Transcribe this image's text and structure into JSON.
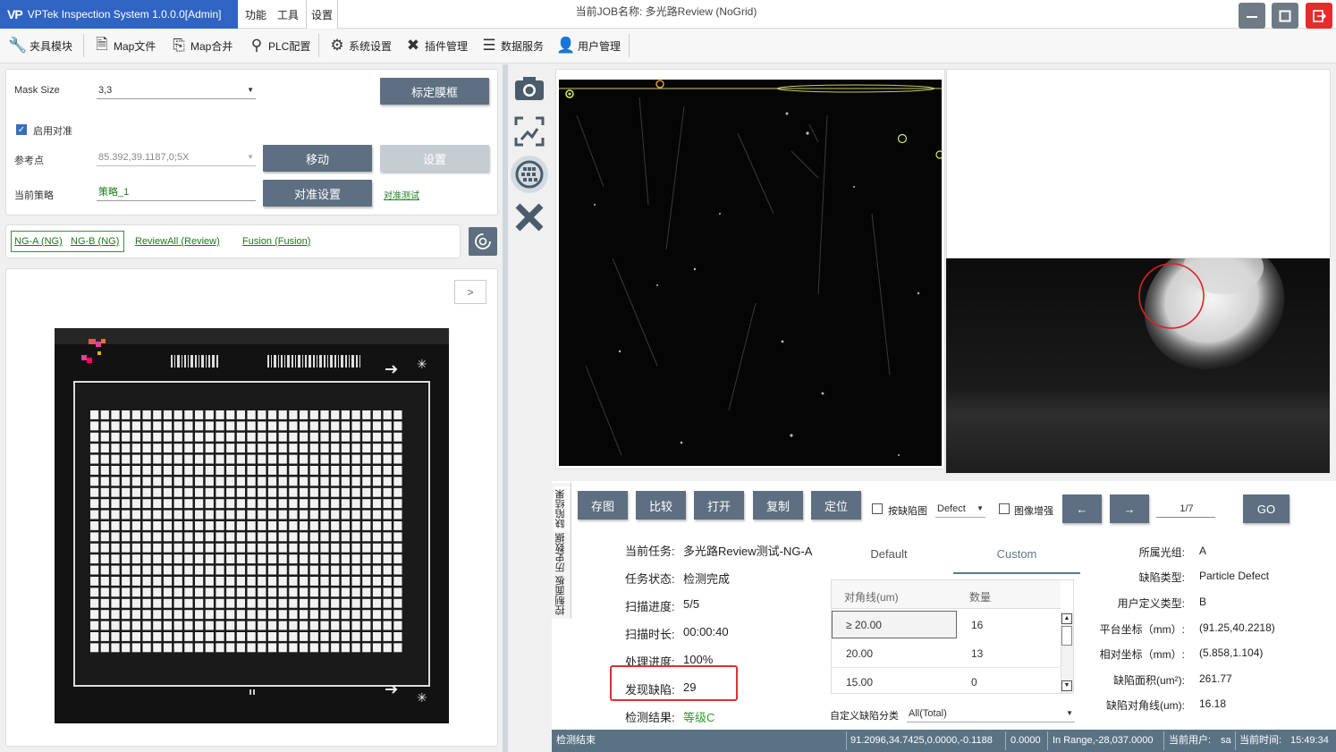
{
  "titlebar": {
    "app_logo": "VP",
    "app_title": "VPTek Inspection System 1.0.0.0[Admin]",
    "menus": [
      "功能",
      "工具",
      "设置"
    ],
    "job_title": "当前JOB名称: 多光路Review (NoGrid)",
    "window_buttons": [
      "minimize-icon",
      "maximize-icon",
      "exit-icon"
    ],
    "exit_color": "#e52b2b"
  },
  "toolbar": [
    {
      "label": "夹具模块",
      "icon": "wrench-icon"
    },
    {
      "label": "Map文件",
      "icon": "document-icon"
    },
    {
      "label": "Map合并",
      "icon": "merge-icon"
    },
    {
      "label": "PLC配置",
      "icon": "plc-icon"
    },
    {
      "label": "系统设置",
      "icon": "gear-icon"
    },
    {
      "label": "插件管理",
      "icon": "tools-icon"
    },
    {
      "label": "数据服务",
      "icon": "server-icon"
    },
    {
      "label": "用户管理",
      "icon": "user-icon"
    }
  ],
  "mask": {
    "label": "Mask Size",
    "value": "3,3",
    "calib_button": "标定膜框",
    "align_enable": "启用对准",
    "ref_label": "参考点",
    "ref_value": "85.392,39.1187,0;5X",
    "move_button": "移动",
    "set_button": "设置",
    "strategy_label": "当前策略",
    "strategy_value": "策略_1",
    "align_settings_button": "对准设置",
    "align_test_link": "对准测试"
  },
  "result_tabs": [
    "NG-A (NG)",
    "NG-B (NG)",
    "ReviewAll (Review)",
    "Fusion (Fusion)"
  ],
  "map": {
    "expand_button": ">"
  },
  "side_icons": [
    "camera-icon",
    "fit-image-icon",
    "wafer-map-icon",
    "measure-icon"
  ],
  "vtabs": [
    "缺陷结果",
    "历史数据",
    "控制面板"
  ],
  "actions": {
    "save": "存图",
    "compare": "比较",
    "open": "打开",
    "copy": "复制",
    "locate": "定位",
    "by_defect_map": "按缺陷图",
    "defect_select": "Defect",
    "enhance": "图像增强",
    "prev": "←",
    "next": "→",
    "page": "1/7",
    "go": "GO"
  },
  "task": {
    "current_task_label": "当前任务:",
    "current_task": "多光路Review测试-NG-A",
    "status_label": "任务状态:",
    "status": "检测完成",
    "scan_progress_label": "扫描进度:",
    "scan_progress": "5/5",
    "scan_time_label": "扫描时长:",
    "scan_time": "00:00:40",
    "process_label": "处理进度:",
    "process": "100%",
    "defects_found_label": "发现缺陷:",
    "defects_found": "29",
    "result_label": "检测结果:",
    "result": "等级C",
    "result_color": "#2e9a2e",
    "highlight_color": "#e03030"
  },
  "table": {
    "tabs": [
      "Default",
      "Custom"
    ],
    "headers": [
      "对角线(um)",
      "数量"
    ],
    "rows": [
      [
        "≥ 20.00",
        "16"
      ],
      [
        "20.00",
        "13"
      ],
      [
        "15.00",
        "0"
      ]
    ],
    "custom_class_label": "自定义缺陷分类",
    "custom_class_value": "All(Total)"
  },
  "defect": {
    "group_label": "所属光组:",
    "group": "A",
    "type_label": "缺陷类型:",
    "type": "Particle Defect",
    "user_type_label": "用户定义类型:",
    "user_type": "B",
    "stage_label": "平台坐标（mm）:",
    "stage": "(91.25,40.2218)",
    "relative_label": "相对坐标（mm）:",
    "relative": "(5.858,1.104)",
    "area_label": "缺陷面积(um²):",
    "area": "261.77",
    "diag_label": "缺陷对角线(um):",
    "diag": "16.18"
  },
  "status": {
    "state": "检测结束",
    "coords": "91.2096,34.7425,0.0000,-0.1188",
    "val": "0.0000",
    "range": "In Range,-28,037.0000",
    "user_label": "当前用户:",
    "user": "sa",
    "time_label": "当前时间:",
    "time": "15:49:34"
  }
}
